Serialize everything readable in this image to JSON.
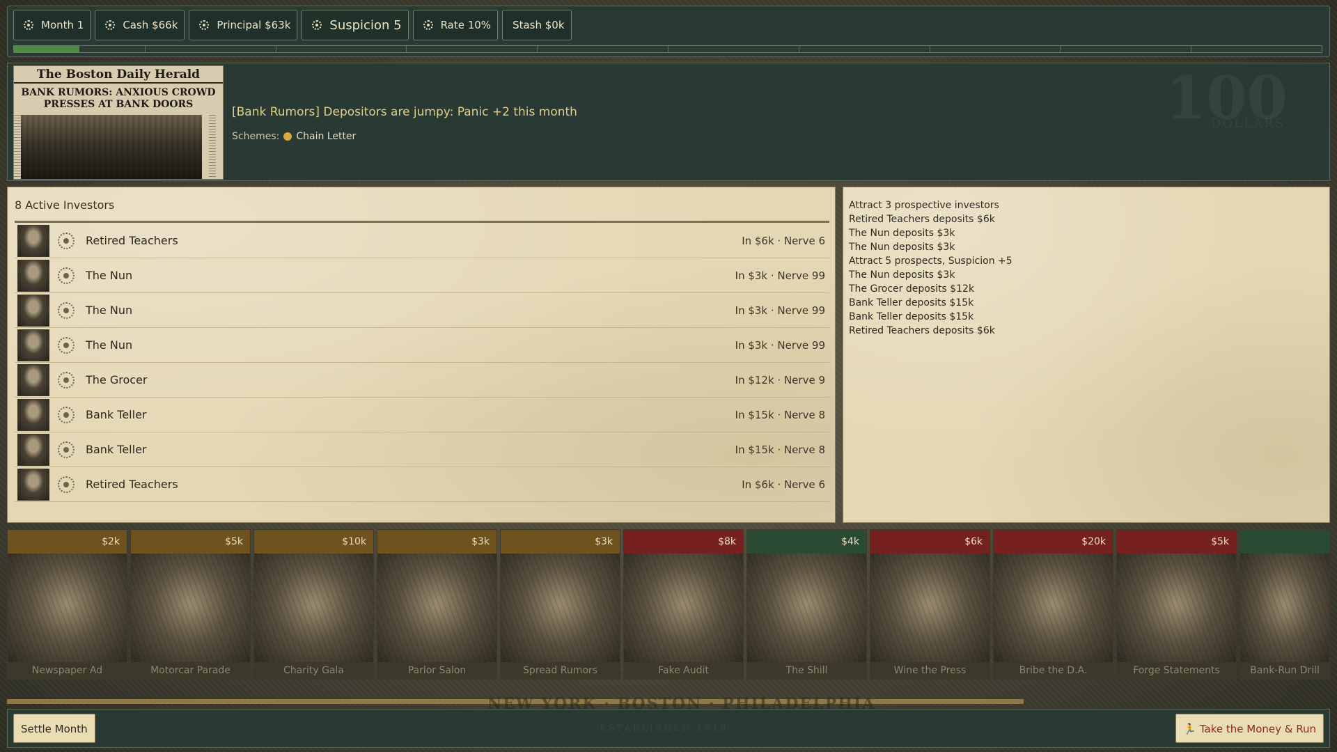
{
  "stats": {
    "month": "Month 1",
    "cash": "Cash $66k",
    "principal": "Principal $63k",
    "suspicion": "Suspicion 5",
    "rate": "Rate 10%",
    "stash": "Stash $0k"
  },
  "progress": {
    "fraction": 0.05
  },
  "event": {
    "newspaper_title": "The Boston Daily Herald",
    "newspaper_headline": "BANK RUMORS: ANXIOUS CROWD PRESSES AT BANK DOORS",
    "text": "[Bank Rumors] Depositors are jumpy: Panic +2 this month",
    "schemes_label": "Schemes:",
    "scheme": "Chain Letter",
    "scheme_color": "#d9a93e"
  },
  "investors": {
    "title": "8 Active Investors",
    "rows": [
      {
        "name": "Retired Teachers",
        "stats": "In $6k · Nerve 6"
      },
      {
        "name": "The Nun",
        "stats": "In $3k · Nerve 99"
      },
      {
        "name": "The Nun",
        "stats": "In $3k · Nerve 99"
      },
      {
        "name": "The Nun",
        "stats": "In $3k · Nerve 99"
      },
      {
        "name": "The Grocer",
        "stats": "In $12k · Nerve 9"
      },
      {
        "name": "Bank Teller",
        "stats": "In $15k · Nerve 8"
      },
      {
        "name": "Bank Teller",
        "stats": "In $15k · Nerve 8"
      },
      {
        "name": "Retired Teachers",
        "stats": "In $6k · Nerve 6"
      }
    ]
  },
  "log": [
    "Attract 3 prospective investors",
    "Retired Teachers deposits $6k",
    "The Nun deposits $3k",
    "The Nun deposits $3k",
    "Attract 5 prospects, Suspicion +5",
    "The Nun deposits $3k",
    "The Grocer deposits $12k",
    "Bank Teller deposits $15k",
    "Bank Teller deposits $15k",
    "Retired Teachers deposits $6k"
  ],
  "cards": [
    {
      "name": "Newspaper Ad",
      "cost": "$2k",
      "tone": "gold"
    },
    {
      "name": "Motorcar Parade",
      "cost": "$5k",
      "tone": "gold"
    },
    {
      "name": "Charity Gala",
      "cost": "$10k",
      "tone": "gold"
    },
    {
      "name": "Parlor Salon",
      "cost": "$3k",
      "tone": "gold"
    },
    {
      "name": "Spread Rumors",
      "cost": "$3k",
      "tone": "gold"
    },
    {
      "name": "Fake Audit",
      "cost": "$8k",
      "tone": "red"
    },
    {
      "name": "The Shill",
      "cost": "$4k",
      "tone": "green"
    },
    {
      "name": "Wine the Press",
      "cost": "$6k",
      "tone": "red"
    },
    {
      "name": "Bribe the D.A.",
      "cost": "$20k",
      "tone": "red"
    },
    {
      "name": "Forge Statements",
      "cost": "$5k",
      "tone": "red"
    },
    {
      "name": "Bank-Run Drill",
      "cost": "",
      "tone": "green"
    }
  ],
  "decor": {
    "bill_number": "100",
    "bill_word": "DOLLARS",
    "banner": "NEW YORK · BOSTON · PHILADELPHIA",
    "established": "ESTABLISHED 1919"
  },
  "actions": {
    "settle": "Settle Month",
    "run": "Take the Money & Run",
    "run_icon": "running-man-icon"
  }
}
